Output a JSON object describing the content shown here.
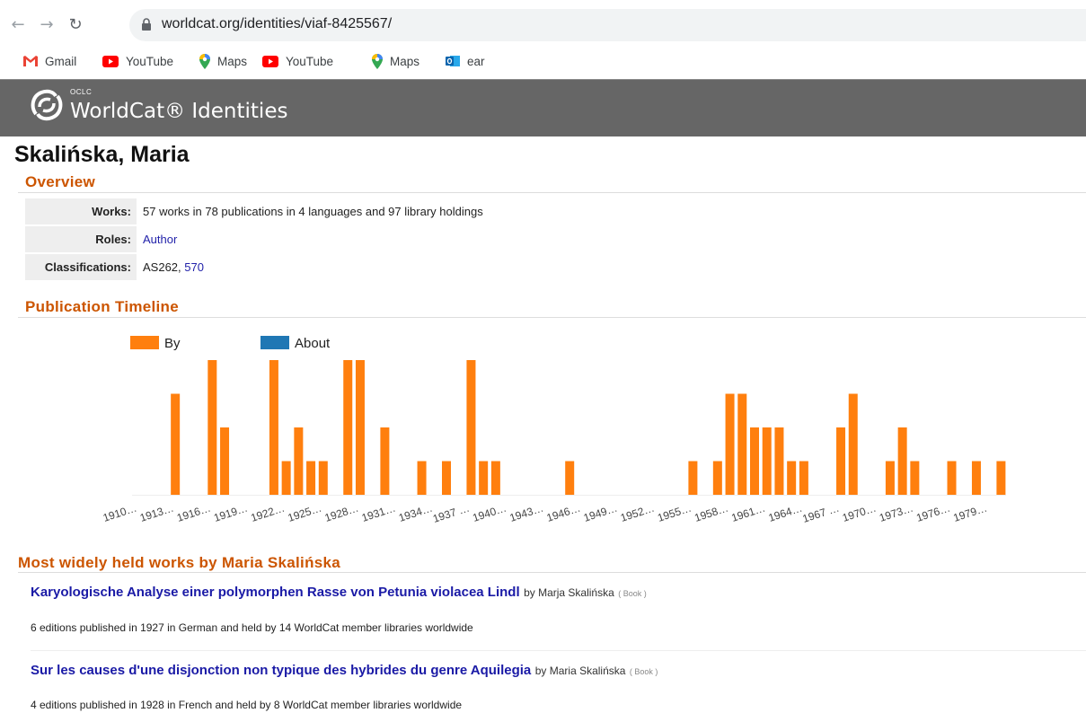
{
  "browser": {
    "url": "worldcat.org/identities/viaf-8425567/",
    "bookmarks": [
      {
        "label": "Gmail",
        "icon": "gmail-icon"
      },
      {
        "label": "YouTube",
        "icon": "youtube-icon"
      },
      {
        "label": "Maps",
        "icon": "maps-icon"
      },
      {
        "label": "YouTube",
        "icon": "youtube-icon"
      },
      {
        "label": "Maps",
        "icon": "maps-icon"
      },
      {
        "label": "ear",
        "icon": "outlook-icon"
      }
    ]
  },
  "header": {
    "oclc": "OCLC",
    "title": "WorldCat® Identities"
  },
  "person": {
    "name": "Skalińska, Maria"
  },
  "overview": {
    "heading": "Overview",
    "works_label": "Works:",
    "works_value": "57 works in 78 publications in 4 languages and 97 library holdings",
    "roles_label": "Roles:",
    "roles_value": "Author",
    "classifications_label": "Classifications:",
    "classifications_plain": "AS262, ",
    "classifications_link": "570"
  },
  "timeline": {
    "heading": "Publication Timeline"
  },
  "chart_data": {
    "type": "bar",
    "series": [
      {
        "name": "By",
        "color": "#ff7f0e"
      },
      {
        "name": "About",
        "color": "#1f77b4"
      }
    ],
    "tick_labels": [
      "1910…",
      "1913…",
      "1916…",
      "1919…",
      "1922…",
      "1925…",
      "1928…",
      "1931…",
      "1934…",
      "1937 …",
      "1940…",
      "1943…",
      "1946…",
      "1949…",
      "1952…",
      "1955…",
      "1958…",
      "1961…",
      "1964…",
      "1967 …",
      "1970…",
      "1973…",
      "1976…",
      "1979…"
    ],
    "x_start": 1910,
    "x_end": 1981,
    "by_values": {
      "1913": 3,
      "1916": 4,
      "1917": 2,
      "1921": 4,
      "1922": 1,
      "1923": 2,
      "1924": 1,
      "1925": 1,
      "1927": 4,
      "1928": 4,
      "1930": 2,
      "1933": 1,
      "1935": 1,
      "1937": 4,
      "1938": 1,
      "1939": 1,
      "1945": 1,
      "1955": 1,
      "1957": 1,
      "1958": 3,
      "1959": 3,
      "1960": 2,
      "1961": 2,
      "1962": 2,
      "1963": 1,
      "1964": 1,
      "1967": 2,
      "1968": 3,
      "1971": 1,
      "1972": 2,
      "1973": 1,
      "1976": 1,
      "1978": 1,
      "1980": 1
    },
    "ylim": [
      0,
      4
    ]
  },
  "works": {
    "heading": "Most widely held works by Maria Skalińska",
    "items": [
      {
        "title": "Karyologische Analyse einer polymorphen Rasse von Petunia violacea Lindl",
        "by": "by Marja Skalińska",
        "type": "( Book )",
        "desc": "6 editions published in 1927 in German and held by 14 WorldCat member libraries worldwide"
      },
      {
        "title": "Sur les causes d'une disjonction non typique des hybrides du genre Aquilegia",
        "by": "by Maria Skalińska",
        "type": "( Book )",
        "desc": "4 editions published in 1928 in French and held by 8 WorldCat member libraries worldwide"
      }
    ]
  }
}
